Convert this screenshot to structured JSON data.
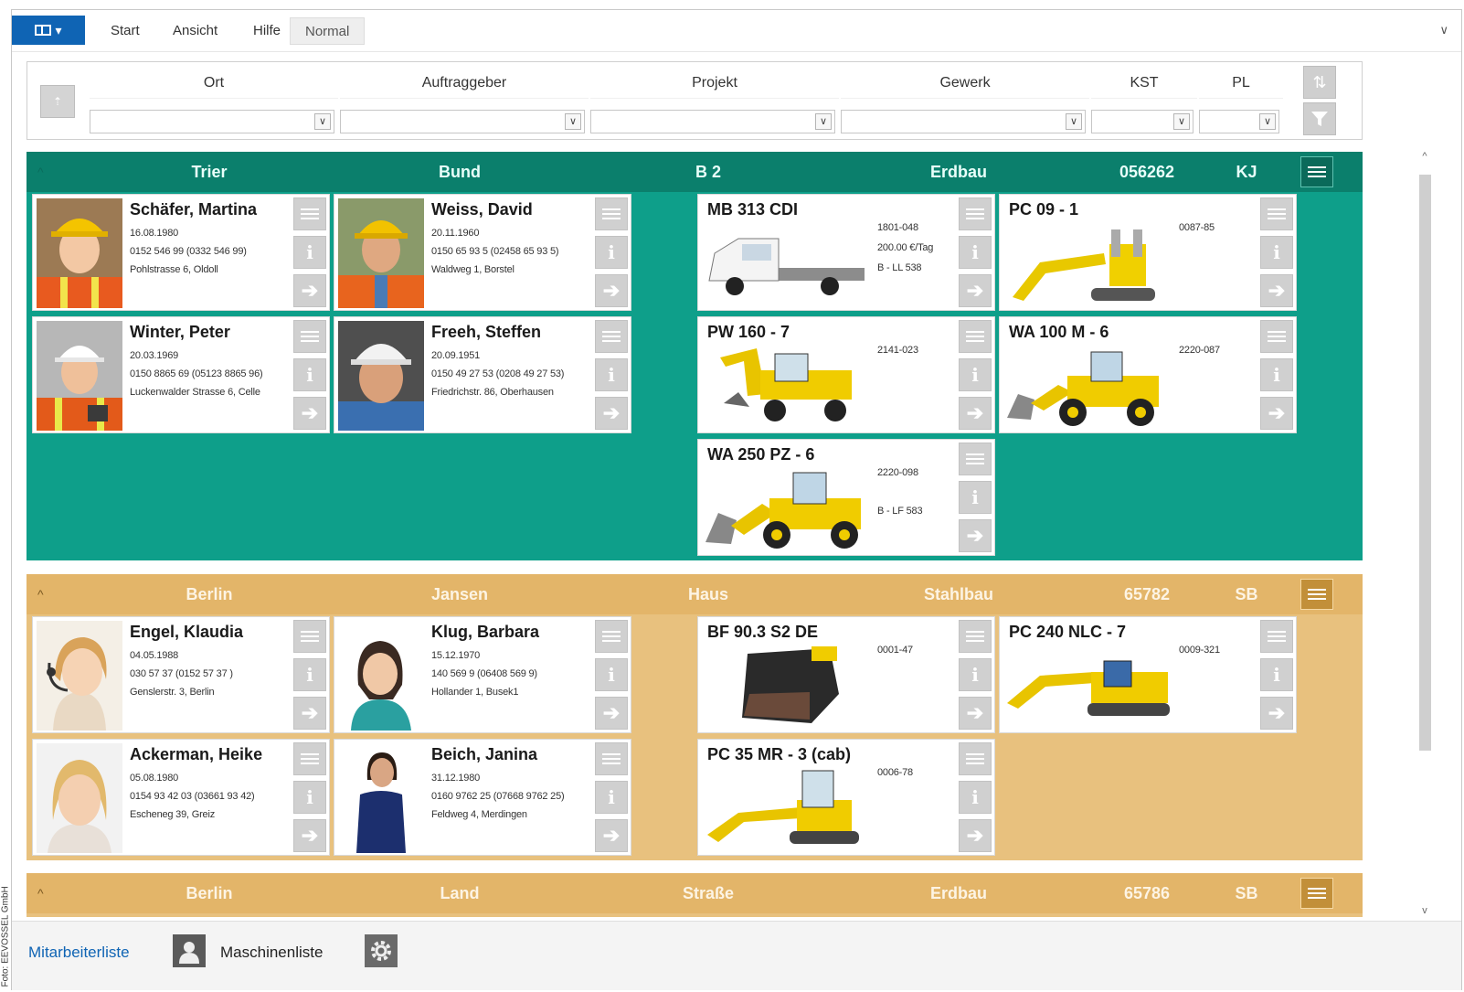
{
  "credit": "Foto: EEVOSSEL GmbH",
  "ribbon": {
    "tabs": [
      {
        "label": "Start"
      },
      {
        "label": "Ansicht"
      },
      {
        "label": "Hilfe"
      },
      {
        "label": "Normal"
      }
    ],
    "app_button_icon": "layout-icon",
    "collapse_icon": "chevron-down-icon"
  },
  "filter": {
    "columns": [
      {
        "label": "Ort",
        "value": ""
      },
      {
        "label": "Auftraggeber",
        "value": ""
      },
      {
        "label": "Projekt",
        "value": ""
      },
      {
        "label": "Gewerk",
        "value": ""
      },
      {
        "label": "KST",
        "value": ""
      },
      {
        "label": "PL",
        "value": ""
      }
    ],
    "dropdown_glyph": "∨",
    "up_glyph": "⇡",
    "side_buttons": [
      "sort-icon",
      "filter-icon"
    ]
  },
  "colors": {
    "green_group": "#0e9f8a",
    "green_header": "#0b7f6c",
    "tan_group": "#e8c17e",
    "tan_header": "#e3b569",
    "accent_blue": "#0f64b4",
    "action_button": "#d0d0d0"
  },
  "groups": [
    {
      "caret": "^",
      "header": [
        "Trier",
        "Bund",
        "B 2",
        "Erdbau",
        "056262",
        "KJ"
      ],
      "people": [
        {
          "name": "Schäfer, Martina",
          "lines": [
            "16.08.1980",
            "0152 546 99 (0332 546 99)",
            "Pohlstrasse 6, Oldoll"
          ]
        },
        {
          "name": "Weiss, David",
          "lines": [
            "20.11.1960",
            "0150 65 93 5 (02458 65 93 5)",
            "Waldweg 1, Borstel"
          ]
        },
        {
          "name": "Winter, Peter",
          "lines": [
            "20.03.1969",
            "0150 8865 69 (05123 8865 96)",
            "Luckenwalder Strasse 6, Celle"
          ]
        },
        {
          "name": "Freeh, Steffen",
          "lines": [
            "20.09.1951",
            "0150 49 27 53 (0208 49 27 53)",
            "Friedrichstr. 86, Oberhausen"
          ]
        }
      ],
      "machines": [
        {
          "name": "MB 313 CDI",
          "lines": [
            "1801-048",
            "200.00 €/Tag",
            "B - LL 538"
          ],
          "kind": "truck"
        },
        {
          "name": "PC 09 - 1",
          "lines": [
            "0087-85"
          ],
          "kind": "mini-excavator"
        },
        {
          "name": "PW 160 - 7",
          "lines": [
            "2141-023"
          ],
          "kind": "wheel-excavator"
        },
        {
          "name": "WA 100 M - 6",
          "lines": [
            "2220-087"
          ],
          "kind": "wheel-loader"
        },
        {
          "name": "WA 250 PZ - 6",
          "lines": [
            "2220-098",
            "B - LF 583"
          ],
          "kind": "wheel-loader"
        }
      ]
    },
    {
      "caret": "^",
      "header": [
        "Berlin",
        "Jansen",
        "Haus",
        "Stahlbau",
        "65782",
        "SB"
      ],
      "people": [
        {
          "name": "Engel, Klaudia",
          "lines": [
            "04.05.1988",
            "030 57 37 (0152 57 37 )",
            "Genslerstr. 3, Berlin"
          ]
        },
        {
          "name": "Klug, Barbara",
          "lines": [
            "15.12.1970",
            "140 569 9 (06408 569 9)",
            "Hollander 1, Busek1"
          ]
        },
        {
          "name": "Ackerman, Heike",
          "lines": [
            "05.08.1980",
            "0154 93 42 03 (03661 93 42)",
            "Escheneg 39, Greiz"
          ]
        },
        {
          "name": "Beich, Janina",
          "lines": [
            "31.12.1980",
            "0160 9762 25 (07668 9762 25)",
            "Feldweg 4, Merdingen"
          ]
        }
      ],
      "machines": [
        {
          "name": "BF 90.3 S2 DE",
          "lines": [
            "0001-47"
          ],
          "kind": "bucket"
        },
        {
          "name": "PC 240 NLC - 7",
          "lines": [
            "0009-321"
          ],
          "kind": "crawler-excavator"
        },
        {
          "name": "PC 35 MR - 3 (cab)",
          "lines": [
            "0006-78"
          ],
          "kind": "mini-excavator"
        }
      ]
    },
    {
      "caret": "^",
      "header": [
        "Berlin",
        "Land",
        "Straße",
        "Erdbau",
        "65786",
        "SB"
      ],
      "people": [],
      "machines": []
    }
  ],
  "bottom": {
    "employees_link": "Mitarbeiterliste",
    "machines_link": "Maschinenliste",
    "icons": [
      "person-icon",
      "gear-icon"
    ]
  }
}
